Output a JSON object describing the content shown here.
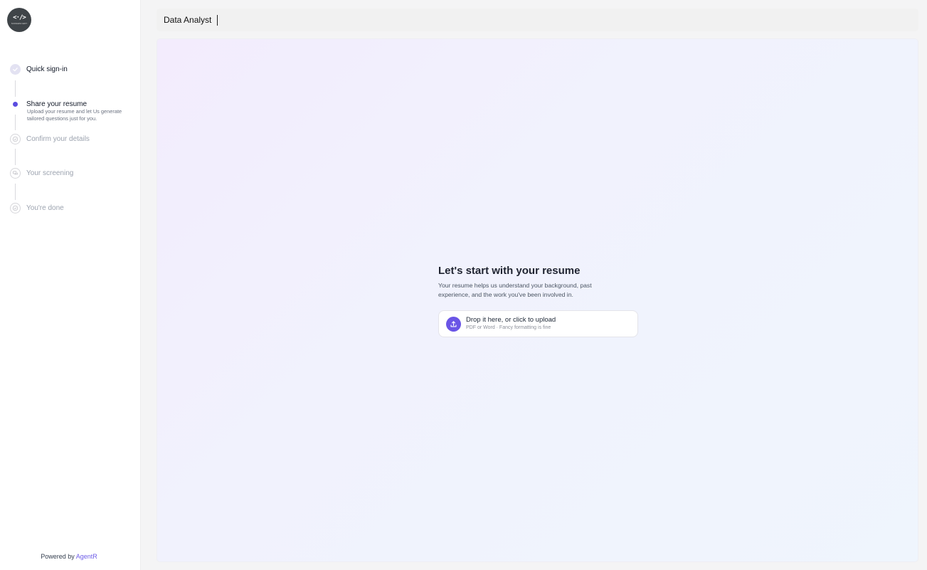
{
  "brand": {
    "logo_glyph": "<·/>",
    "logo_text": "SCREENCERT"
  },
  "steps": [
    {
      "label": "Quick sign-in",
      "status": "done",
      "icon": "check-icon"
    },
    {
      "label": "Share your resume",
      "status": "active",
      "description": "Upload your resume and let Us generate tailored questions just for you.",
      "icon": "active-dot-icon"
    },
    {
      "label": "Confirm your details",
      "status": "pending",
      "icon": "check-circle-icon"
    },
    {
      "label": "Your screening",
      "status": "pending",
      "icon": "chat-icon"
    },
    {
      "label": "You're done",
      "status": "pending",
      "icon": "check-circle-icon"
    }
  ],
  "footer": {
    "powered_prefix": "Powered by",
    "powered_brand": "AgentR"
  },
  "topbar": {
    "job_title": "Data Analyst"
  },
  "main": {
    "heading": "Let's start with your resume",
    "subtext": "Your resume helps us understand your background, past experience, and the work you've been involved in.",
    "upload": {
      "title": "Drop it here, or click to upload",
      "hint": "PDF or Word · Fancy formatting is fine",
      "icon": "upload-icon"
    }
  },
  "colors": {
    "accent": "#6a55e6",
    "brand_link": "#6d5ce8"
  }
}
